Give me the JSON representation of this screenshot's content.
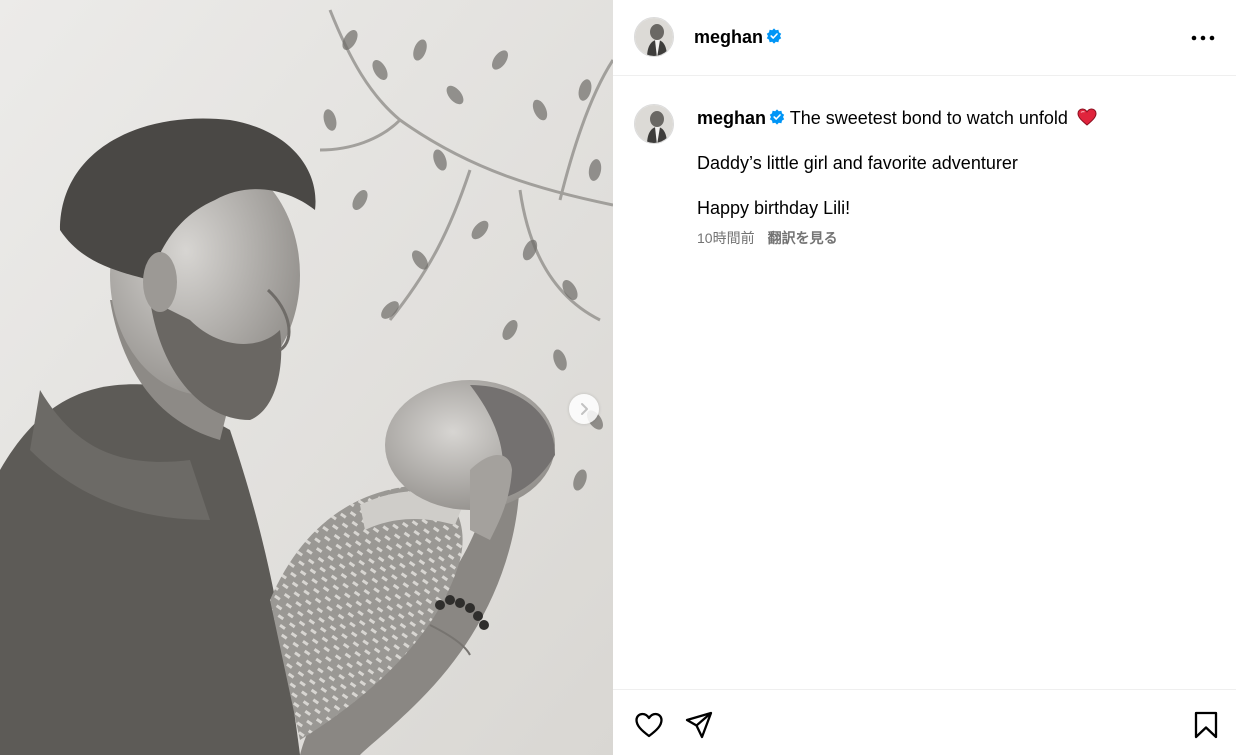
{
  "post": {
    "username": "meghan",
    "verified": true,
    "image_description_icon": "photo"
  },
  "header": {
    "username": "meghan",
    "more_icon": "more-horizontal-icon"
  },
  "caption": {
    "username": "meghan",
    "line1": "The sweetest bond to watch unfold",
    "emoji": "❤️",
    "line2": "Daddy’s little girl and favorite adventurer",
    "line3": "Happy birthday Lili!",
    "timestamp": "10時間前",
    "translate_label": "翻訳を見る"
  },
  "actions": {
    "like_icon": "heart-icon",
    "share_icon": "send-icon",
    "save_icon": "bookmark-icon"
  },
  "colors": {
    "verified_blue": "#0095f6",
    "heart_red": "#e0243c",
    "meta_gray": "#737373",
    "divider": "#efefef"
  }
}
